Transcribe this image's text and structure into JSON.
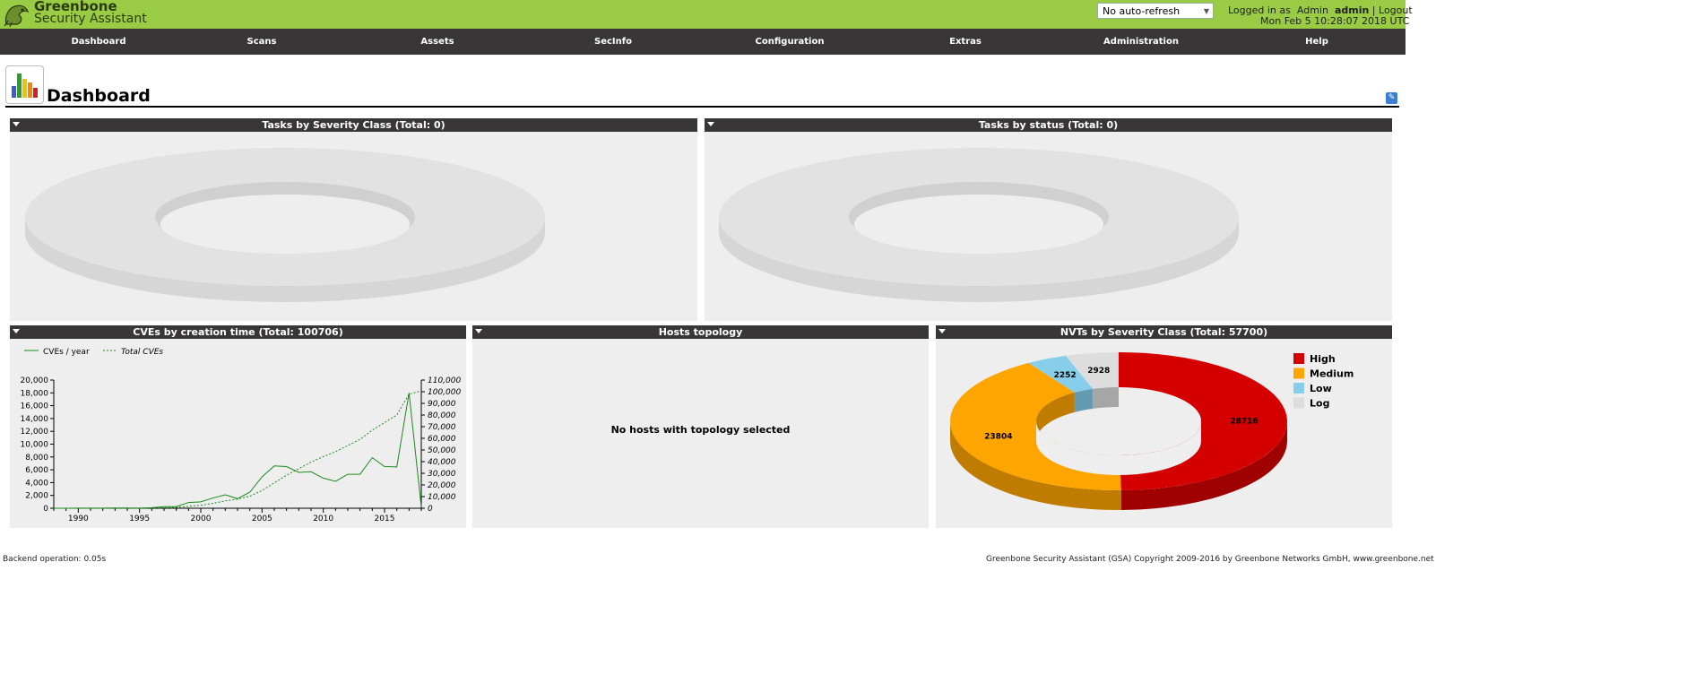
{
  "header": {
    "brand_line1": "Greenbone",
    "brand_line2": "Security Assistant",
    "refresh_value": "No auto-refresh",
    "logged_in_prefix": "Logged in as",
    "role": "Admin",
    "username": "admin",
    "logout_label": "Logout",
    "datetime": "Mon Feb 5 10:28:07 2018 UTC"
  },
  "nav": {
    "items": [
      "Dashboard",
      "Scans",
      "Assets",
      "SecInfo",
      "Configuration",
      "Extras",
      "Administration",
      "Help"
    ]
  },
  "page": {
    "title": "Dashboard"
  },
  "panels": {
    "tasks_severity": {
      "title": "Tasks by Severity Class (Total: 0)"
    },
    "tasks_status": {
      "title": "Tasks by status (Total: 0)"
    },
    "cves": {
      "title": "CVEs by creation time (Total: 100706)",
      "legend_year": "CVEs / year",
      "legend_total": "Total CVEs"
    },
    "hosts": {
      "title": "Hosts topology",
      "empty_message": "No hosts with topology selected"
    },
    "nvts": {
      "title": "NVTs by Severity Class (Total: 57700)",
      "legend": [
        "High",
        "Medium",
        "Low",
        "Log"
      ]
    }
  },
  "chart_data": [
    {
      "type": "line",
      "title": "CVEs by creation time (Total: 100706)",
      "x": [
        1988,
        1989,
        1990,
        1991,
        1992,
        1993,
        1994,
        1995,
        1996,
        1997,
        1998,
        1999,
        2000,
        2001,
        2002,
        2003,
        2004,
        2005,
        2006,
        2007,
        2008,
        2009,
        2010,
        2011,
        2012,
        2013,
        2014,
        2015,
        2016,
        2017,
        2018
      ],
      "xticks": [
        1990,
        1995,
        2000,
        2005,
        2010,
        2015
      ],
      "y_left_ticks": [
        "0",
        "2,000",
        "4,000",
        "6,000",
        "8,000",
        "10,000",
        "12,000",
        "14,000",
        "16,000",
        "18,000",
        "20,000"
      ],
      "y_right_ticks": [
        "0",
        "10,000",
        "20,000",
        "30,000",
        "40,000",
        "50,000",
        "60,000",
        "70,000",
        "80,000",
        "90,000",
        "100,000",
        "110,000"
      ],
      "y_left_lim": [
        0,
        20000
      ],
      "y_right_lim": [
        0,
        110000
      ],
      "series": [
        {
          "name": "CVEs / year",
          "axis": "left",
          "values": [
            1,
            2,
            10,
            15,
            15,
            30,
            30,
            25,
            80,
            250,
            250,
            900,
            1000,
            1600,
            2100,
            1500,
            2500,
            4900,
            6600,
            6500,
            5600,
            5700,
            4700,
            4200,
            5300,
            5300,
            7900,
            6500,
            6450,
            18000,
            200
          ]
        },
        {
          "name": "Total CVEs",
          "axis": "right",
          "values": [
            1,
            3,
            13,
            28,
            43,
            73,
            103,
            128,
            208,
            458,
            708,
            1608,
            2608,
            4208,
            6308,
            7808,
            10308,
            15208,
            21808,
            28308,
            33908,
            39608,
            44308,
            48508,
            53808,
            59108,
            67008,
            73508,
            79958,
            97958,
            100706
          ]
        }
      ]
    },
    {
      "type": "pie",
      "title": "NVTs by Severity Class (Total: 57700)",
      "categories": [
        "High",
        "Medium",
        "Low",
        "Log"
      ],
      "values": [
        28716,
        23804,
        2252,
        2928
      ],
      "colors": [
        "#d40000",
        "#ffa500",
        "#87ceeb",
        "#dddddd"
      ]
    }
  ]
}
